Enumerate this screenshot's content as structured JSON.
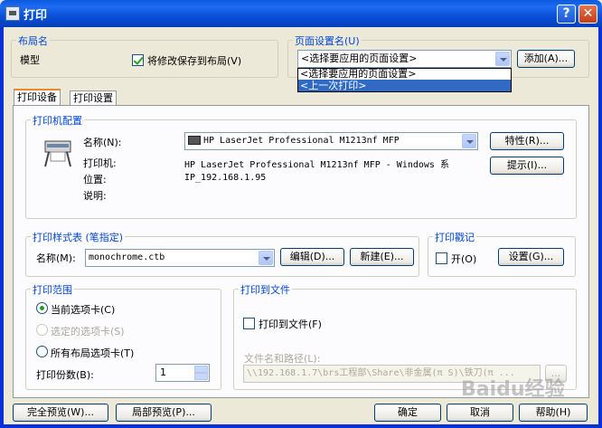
{
  "title": "打印",
  "layout_group": {
    "legend": "布局名",
    "value": "模型",
    "save_checkbox_label": "将修改保存到布局(V)",
    "save_checked": true
  },
  "page_setup_group": {
    "legend": "页面设置名(U)",
    "selected": "<选择要应用的页面设置>",
    "add_button": "添加(A)...",
    "dropdown_options": [
      "<选择要应用的页面设置>",
      "<上一次打印>"
    ]
  },
  "tabs": [
    "打印设备",
    "打印设置"
  ],
  "printer_group": {
    "legend": "打印机配置",
    "name_label": "名称(N):",
    "name_value": "HP LaserJet Professional M1213nf MFP",
    "printer_label": "打印机:",
    "printer_value": "HP LaserJet Professional M1213nf MFP - Windows 系",
    "location_label": "位置:",
    "location_value": "IP_192.168.1.95",
    "description_label": "说明:",
    "properties_button": "特性(R)...",
    "hints_button": "提示(I)..."
  },
  "plot_style_group": {
    "legend": "打印样式表 (笔指定)",
    "name_label": "名称(M):",
    "value": "monochrome.ctb",
    "edit_button": "编辑(D)...",
    "new_button": "新建(E)..."
  },
  "stamp_group": {
    "legend": "打印戳记",
    "on_label": "开(O)",
    "on_checked": false,
    "settings_button": "设置(G)..."
  },
  "range_group": {
    "legend": "打印范围",
    "options": [
      "当前选项卡(C)",
      "选定的选项卡(S)",
      "所有布局选项卡(T)"
    ],
    "selected_index": 0,
    "copies_label": "打印份数(B):",
    "copies_value": "1"
  },
  "file_group": {
    "legend": "打印到文件",
    "checkbox_label": "打印到文件(F)",
    "checked": false,
    "path_label": "文件名和路径(L):",
    "path_value": "\\\\192.168.1.7\\brs工程部\\Share\\非金属(π S)\\铁刀(π ..."
  },
  "footer": {
    "full_preview": "完全预览(W)...",
    "partial_preview": "局部预览(P)...",
    "ok": "确定",
    "cancel": "取消",
    "help": "帮助(H)"
  },
  "watermark": "Baidu经验"
}
